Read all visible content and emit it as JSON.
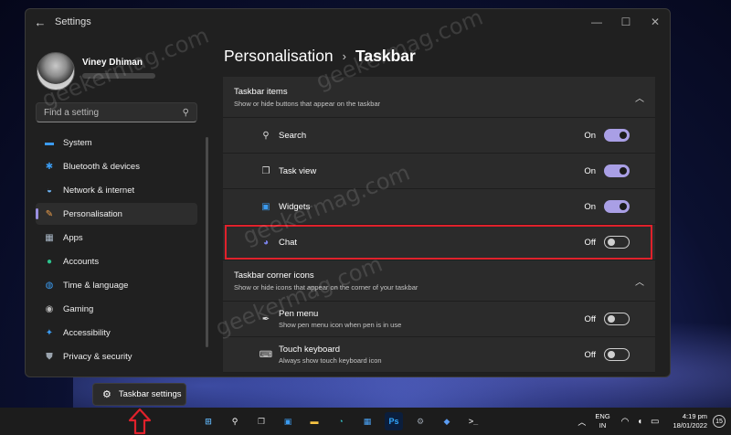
{
  "window": {
    "title": "Settings",
    "back_icon": "←",
    "controls": [
      "—",
      "☐",
      "✕"
    ]
  },
  "profile": {
    "name": "Viney Dhiman"
  },
  "search": {
    "placeholder": "Find a setting"
  },
  "nav": {
    "items": [
      {
        "label": "System",
        "icon": "system-icon",
        "glyph": "▬",
        "color": "#3b9bf0"
      },
      {
        "label": "Bluetooth & devices",
        "icon": "bluetooth-icon",
        "glyph": "✱",
        "color": "#3b9bf0"
      },
      {
        "label": "Network & internet",
        "icon": "wifi-icon",
        "glyph": "◒",
        "color": "#6fb6f7"
      },
      {
        "label": "Personalisation",
        "icon": "brush-icon",
        "glyph": "✎",
        "color": "#f0a04b",
        "active": true
      },
      {
        "label": "Apps",
        "icon": "apps-icon",
        "glyph": "▦",
        "color": "#a9b7c6"
      },
      {
        "label": "Accounts",
        "icon": "accounts-icon",
        "glyph": "●",
        "color": "#2dc28d"
      },
      {
        "label": "Time & language",
        "icon": "globe-icon",
        "glyph": "◍",
        "color": "#3b9bf0"
      },
      {
        "label": "Gaming",
        "icon": "gamepad-icon",
        "glyph": "◉",
        "color": "#bbbbbb"
      },
      {
        "label": "Accessibility",
        "icon": "accessibility-icon",
        "glyph": "✦",
        "color": "#3b9bf0"
      },
      {
        "label": "Privacy & security",
        "icon": "shield-icon",
        "glyph": "⛊",
        "color": "#9aa3ad"
      }
    ]
  },
  "breadcrumb": {
    "parent": "Personalisation",
    "separator": "›",
    "current": "Taskbar"
  },
  "taskbar_items": {
    "title": "Taskbar items",
    "subtitle": "Show or hide buttons that appear on the taskbar",
    "chevron": "︿",
    "items": [
      {
        "label": "Search",
        "state": "On",
        "on": true,
        "icon": "search-icon",
        "glyph": "⚲"
      },
      {
        "label": "Task view",
        "state": "On",
        "on": true,
        "icon": "task-view-icon",
        "glyph": "❐"
      },
      {
        "label": "Widgets",
        "state": "On",
        "on": true,
        "icon": "widgets-icon",
        "glyph": "▣"
      },
      {
        "label": "Chat",
        "state": "Off",
        "on": false,
        "icon": "chat-icon",
        "glyph": "◕"
      }
    ]
  },
  "corner_icons": {
    "title": "Taskbar corner icons",
    "subtitle": "Show or hide icons that appear on the corner of your taskbar",
    "chevron": "︿",
    "items": [
      {
        "label": "Pen menu",
        "sub": "Show pen menu icon when pen is in use",
        "state": "Off",
        "on": false,
        "icon": "pen-icon",
        "glyph": "✒"
      },
      {
        "label": "Touch keyboard",
        "sub": "Always show touch keyboard icon",
        "state": "Off",
        "on": false,
        "icon": "keyboard-icon",
        "glyph": "⌨"
      }
    ]
  },
  "tooltip": {
    "label": "Taskbar settings",
    "icon": "gear-icon",
    "glyph": "⚙"
  },
  "watermark": "geekermag.com",
  "taskbar": {
    "apps": [
      {
        "name": "start-icon",
        "glyph": "⊞",
        "bg": "#1c1c1c",
        "color": "#5fb4f5"
      },
      {
        "name": "search-icon",
        "glyph": "⚲",
        "bg": "#1c1c1c",
        "color": "#ffffff"
      },
      {
        "name": "task-view-icon",
        "glyph": "❐",
        "bg": "#1c1c1c",
        "color": "#cccccc"
      },
      {
        "name": "widgets-icon",
        "glyph": "▣",
        "bg": "#1c1c1c",
        "color": "#3b9bf0"
      },
      {
        "name": "file-explorer-icon",
        "glyph": "▬",
        "bg": "#1c1c1c",
        "color": "#f6c343"
      },
      {
        "name": "edge-icon",
        "glyph": "◔",
        "bg": "#1c1c1c",
        "color": "#34c3c9"
      },
      {
        "name": "store-icon",
        "glyph": "▦",
        "bg": "#1c1c1c",
        "color": "#4aa3f7"
      },
      {
        "name": "photoshop-icon",
        "glyph": "Ps",
        "bg": "#0b1e3c",
        "color": "#31a8ff"
      },
      {
        "name": "settings-icon",
        "glyph": "⚙",
        "bg": "#1c1c1c",
        "color": "#9aa3ad"
      },
      {
        "name": "package-icon",
        "glyph": "◆",
        "bg": "#1c1c1c",
        "color": "#5b9cf2"
      },
      {
        "name": "terminal-icon",
        "glyph": ">_",
        "bg": "#1c1c1c",
        "color": "#cccccc"
      }
    ],
    "chevron": "︿",
    "lang_1": "ENG",
    "lang_2": "IN",
    "sys_icons": "◠ ◖ ▭",
    "time": "4:19 pm",
    "date": "18/01/2022",
    "notification_count": "15"
  }
}
